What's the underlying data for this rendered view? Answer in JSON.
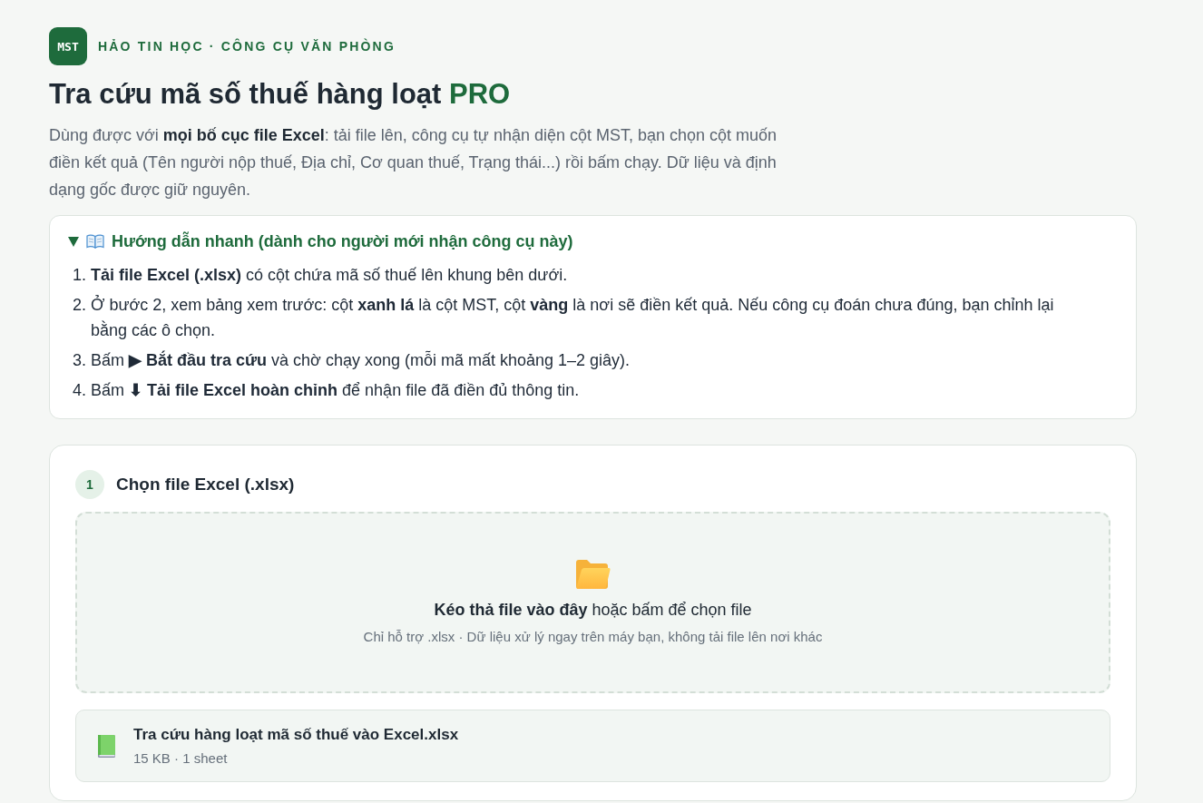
{
  "brand": {
    "logo": "MST",
    "name": "HẢO TIN HỌC · CÔNG CỤ VĂN PHÒNG"
  },
  "title": {
    "text": "Tra cứu mã số thuế hàng loạt",
    "highlight": "PRO"
  },
  "description": "Dùng được với **mọi bố cục file Excel**: tải file lên, công cụ tự nhận diện cột MST, bạn chọn cột muốn điền kết quả (Tên người nộp thuế, Địa chỉ, Cơ quan thuế, Trạng thái...) rồi bấm chạy. Dữ liệu và định dạng gốc được giữ nguyên.",
  "guide": {
    "expanded": true,
    "title": "Hướng dẫn nhanh (dành cho người mới nhận công cụ này)",
    "steps": [
      {
        "number": "1.",
        "text": "**Tải file Excel (.xlsx)** có cột chứa mã số thuế lên khung bên dưới."
      },
      {
        "number": "2.",
        "text": "Ở bước 2, xem bảng xem trước: cột **xanh lá** là cột MST, cột **vàng** là nơi sẽ điền kết quả. Nếu công cụ đoán chưa đúng, bạn chỉnh lại bằng các ô chọn."
      },
      {
        "number": "3.",
        "text": "Bấm **▶ Bắt đầu tra cứu** và chờ chạy xong (mỗi mã mất khoảng 1–2 giây)."
      },
      {
        "number": "4.",
        "text": "Bấm **⬇ Tải file Excel hoàn chỉnh** để nhận file đã điền đủ thông tin."
      }
    ]
  },
  "step": {
    "number": "1",
    "title": "Chọn file Excel (.xlsx)",
    "dropzone": {
      "prompt": "**Kéo thả file vào đây** hoặc bấm để chọn file",
      "hint": "Chỉ hỗ trợ .xlsx · Dữ liệu xử lý ngay trên máy bạn, không tải file lên nơi khác"
    },
    "file": {
      "name": "Tra cứu hàng loạt mã số thuế vào Excel.xlsx",
      "meta": "15 KB · 1 sheet"
    }
  }
}
